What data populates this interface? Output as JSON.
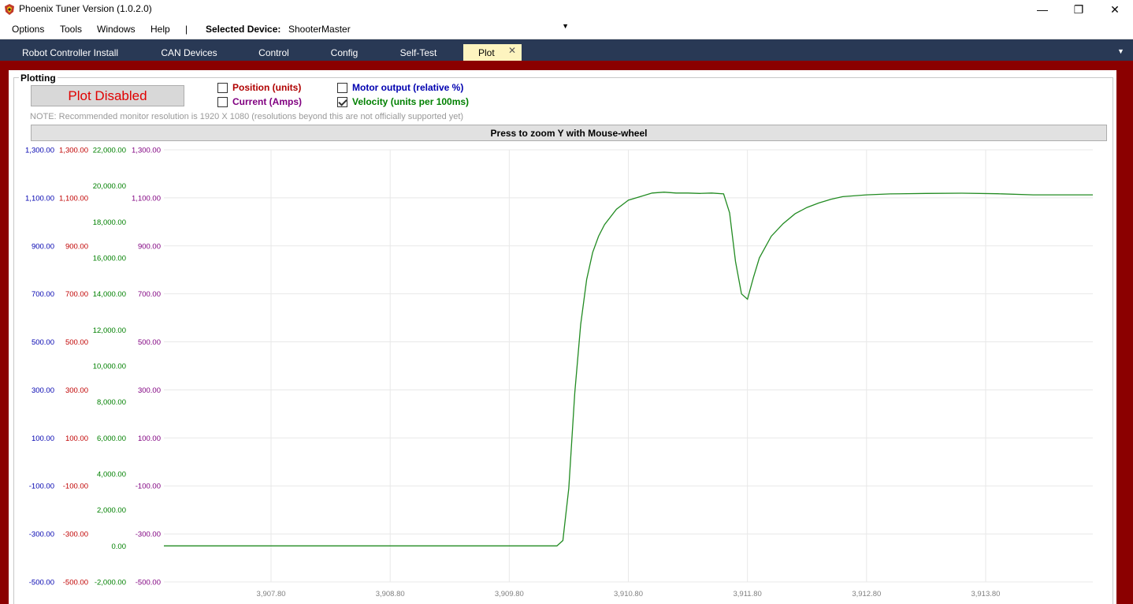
{
  "window": {
    "title": "Phoenix Tuner Version (1.0.2.0)",
    "minimize": "—",
    "maximize": "❐",
    "close": "✕"
  },
  "menu": {
    "options": "Options",
    "tools": "Tools",
    "windows": "Windows",
    "help": "Help",
    "separator": "|",
    "device_label": "Selected Device:",
    "device_value": "ShooterMaster",
    "device_arrow": "▼"
  },
  "tabs": [
    {
      "label": "Robot Controller Install"
    },
    {
      "label": "CAN Devices"
    },
    {
      "label": "Control"
    },
    {
      "label": "Config"
    },
    {
      "label": "Self-Test"
    },
    {
      "label": "Plot"
    }
  ],
  "tab_close": "✕",
  "tab_overflow": "▼",
  "plotting": {
    "group_title": "Plotting",
    "plot_button": "Plot Disabled",
    "checkboxes": {
      "position": {
        "label": "Position (units)",
        "checked": false,
        "color": "#b00000"
      },
      "current": {
        "label": "Current (Amps)",
        "checked": false,
        "color": "#800080"
      },
      "motor_output": {
        "label": "Motor output (relative %)",
        "checked": false,
        "color": "#0000b0"
      },
      "velocity": {
        "label": "Velocity (units per 100ms)",
        "checked": true,
        "color": "#008000"
      }
    },
    "note": "NOTE: Recommended monitor resolution is 1920 X 1080 (resolutions beyond this are not officially supported yet)",
    "zoom_button": "Press to zoom Y with Mouse-wheel"
  },
  "chart_data": {
    "type": "line",
    "x_ticks": [
      "3,907.80",
      "3,908.80",
      "3,909.80",
      "3,910.80",
      "3,911.80",
      "3,912.80",
      "3,913.80"
    ],
    "x_tick_values": [
      3907.8,
      3908.8,
      3909.8,
      3910.8,
      3911.8,
      3912.8,
      3913.8
    ],
    "xlim": [
      3906.9,
      3914.7
    ],
    "axes": [
      {
        "name": "motor_output",
        "color": "#0000b0",
        "ylim": [
          -500,
          1300
        ],
        "ticks": [
          "-500.00",
          "-300.00",
          "-100.00",
          "100.00",
          "300.00",
          "500.00",
          "700.00",
          "900.00",
          "1,100.00",
          "1,300.00"
        ]
      },
      {
        "name": "position",
        "color": "#c00000",
        "ylim": [
          -500,
          1300
        ],
        "ticks": [
          "-500.00",
          "-300.00",
          "-100.00",
          "100.00",
          "300.00",
          "500.00",
          "700.00",
          "900.00",
          "1,100.00",
          "1,300.00"
        ]
      },
      {
        "name": "velocity",
        "color": "#008000",
        "ylim": [
          -2000,
          22000
        ],
        "ticks": [
          "-2,000.00",
          "0.00",
          "2,000.00",
          "4,000.00",
          "6,000.00",
          "8,000.00",
          "10,000.00",
          "12,000.00",
          "14,000.00",
          "16,000.00",
          "18,000.00",
          "20,000.00",
          "22,000.00"
        ]
      },
      {
        "name": "current",
        "color": "#800080",
        "ylim": [
          -500,
          1300
        ],
        "ticks": [
          "-500.00",
          "-300.00",
          "-100.00",
          "100.00",
          "300.00",
          "500.00",
          "700.00",
          "900.00",
          "1,100.00",
          "1,300.00"
        ]
      }
    ],
    "series": [
      {
        "color": "#228b22",
        "axis": "velocity",
        "x": [
          3906.9,
          3909.2,
          3910.2,
          3910.25,
          3910.3,
          3910.35,
          3910.4,
          3910.45,
          3910.5,
          3910.55,
          3910.6,
          3910.7,
          3910.8,
          3910.9,
          3911.0,
          3911.1,
          3911.2,
          3911.3,
          3911.4,
          3911.5,
          3911.6,
          3911.65,
          3911.7,
          3911.75,
          3911.8,
          3911.85,
          3911.9,
          3912.0,
          3912.1,
          3912.2,
          3912.3,
          3912.4,
          3912.5,
          3912.6,
          3912.8,
          3913.0,
          3913.3,
          3913.6,
          3913.9,
          3914.2,
          3914.7
        ],
        "y": [
          0,
          0,
          0,
          300,
          3200,
          8500,
          12300,
          14800,
          16300,
          17200,
          17850,
          18700,
          19200,
          19400,
          19600,
          19650,
          19600,
          19600,
          19580,
          19600,
          19550,
          18500,
          15800,
          14000,
          13700,
          14900,
          16000,
          17200,
          17900,
          18450,
          18800,
          19050,
          19250,
          19400,
          19500,
          19550,
          19580,
          19590,
          19560,
          19500,
          19500
        ]
      }
    ],
    "grid": true,
    "legend": "none"
  }
}
